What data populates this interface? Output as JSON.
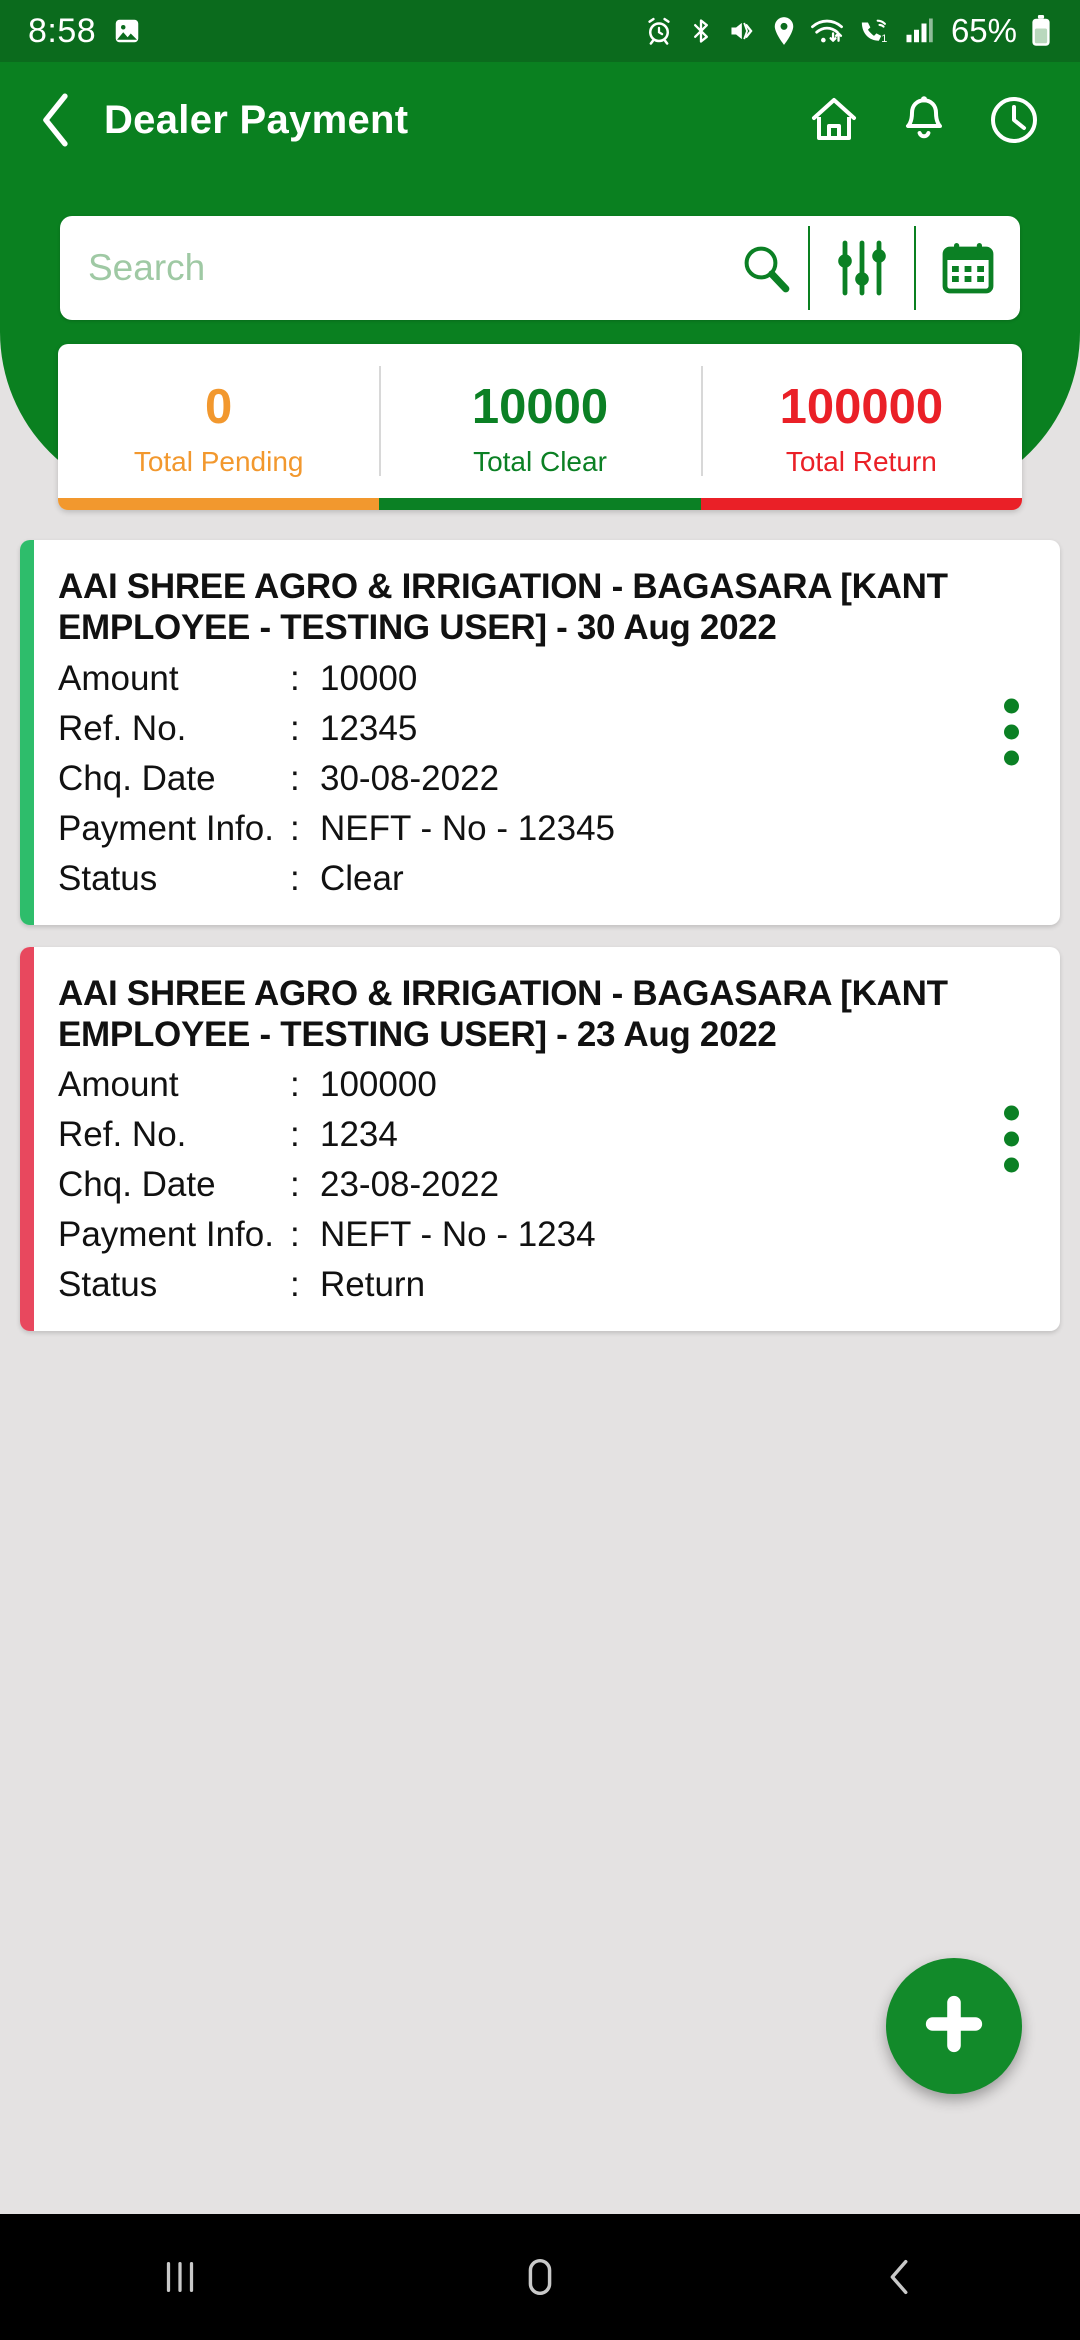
{
  "status_bar": {
    "time": "8:58",
    "battery_percent": "65%",
    "icons": [
      "image-icon",
      "alarm-icon",
      "bluetooth-icon",
      "vibrate-icon",
      "location-icon",
      "wifi-icon",
      "call-wifi-icon",
      "signal-icon",
      "battery-icon"
    ]
  },
  "app_bar": {
    "back_icon": "chevron-left-icon",
    "title": "Dealer Payment",
    "actions": [
      {
        "name": "home-icon"
      },
      {
        "name": "bell-icon"
      },
      {
        "name": "clock-icon"
      }
    ]
  },
  "search": {
    "value": "",
    "placeholder": "Search",
    "search_icon": "magnifier-icon",
    "filter_icon": "sliders-icon",
    "calendar_icon": "calendar-icon"
  },
  "summary": {
    "cells": [
      {
        "value": "0",
        "label": "Total Pending",
        "color": "#f2982e"
      },
      {
        "value": "10000",
        "label": "Total Clear",
        "color": "#0b8024"
      },
      {
        "value": "100000",
        "label": "Total Return",
        "color": "#ea2027"
      }
    ]
  },
  "labels": {
    "amount": "Amount",
    "ref_no": "Ref. No.",
    "chq_date": "Chq. Date",
    "payment_info": "Payment Info.",
    "status": "Status",
    "colon": ":"
  },
  "payments": [
    {
      "title": "AAI SHREE AGRO & IRRIGATION - BAGASARA [KANT EMPLOYEE - TESTING USER] - 30 Aug 2022",
      "amount": "10000",
      "ref_no": "12345",
      "chq_date": "30-08-2022",
      "payment_info": "NEFT  - No - 12345",
      "status": "Clear",
      "stripe_color": "#2ebd6b"
    },
    {
      "title": "AAI SHREE AGRO & IRRIGATION - BAGASARA [KANT EMPLOYEE - TESTING USER] - 23 Aug 2022",
      "amount": "100000",
      "ref_no": "1234",
      "chq_date": "23-08-2022",
      "payment_info": "NEFT  - No - 1234",
      "status": "Return",
      "stripe_color": "#e8485e"
    }
  ],
  "fab": {
    "icon": "plus-icon"
  },
  "nav_bar": {
    "recents_icon": "recents-icon",
    "home_icon": "home-square-icon",
    "back_icon": "back-chevron-icon"
  },
  "theme": {
    "status_bar_green": "#0b6b1d",
    "header_green": "#0a8020",
    "page_bg": "#e4e2e2",
    "fab_green": "#128a2a"
  }
}
